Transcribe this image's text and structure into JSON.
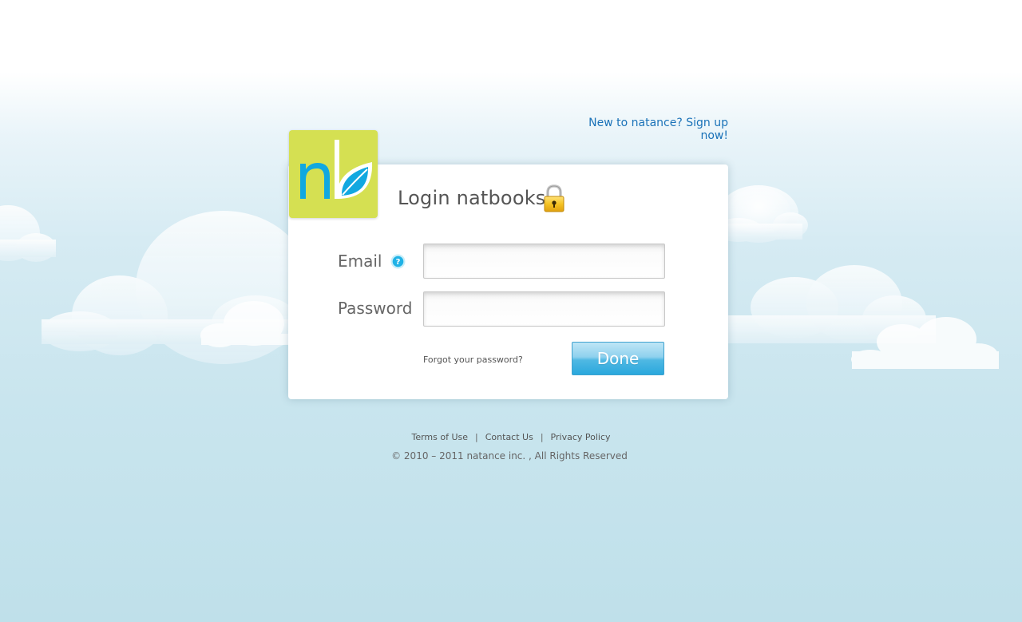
{
  "header": {
    "signup_link": "New to natance? Sign up now!"
  },
  "logo": {
    "text": "nb"
  },
  "login_card": {
    "title": "Login natbooks",
    "email_label": "Email",
    "email_value": "",
    "password_label": "Password",
    "password_value": "",
    "forgot_link": "Forgot your password?",
    "submit_label": "Done"
  },
  "footer": {
    "links": [
      "Terms of Use",
      "Contact Us",
      "Privacy Policy"
    ],
    "separator": "|",
    "copyright": "©  2010 – 2011 natance inc. , All Rights Reserved"
  },
  "colors": {
    "logo_background": "#d5e052",
    "logo_accent": "#11a8e0",
    "link": "#1a72b8",
    "button": "#2aa8dd"
  },
  "icons": {
    "lock": "lock-icon",
    "help": "help-icon",
    "leaf": "leaf-icon"
  }
}
